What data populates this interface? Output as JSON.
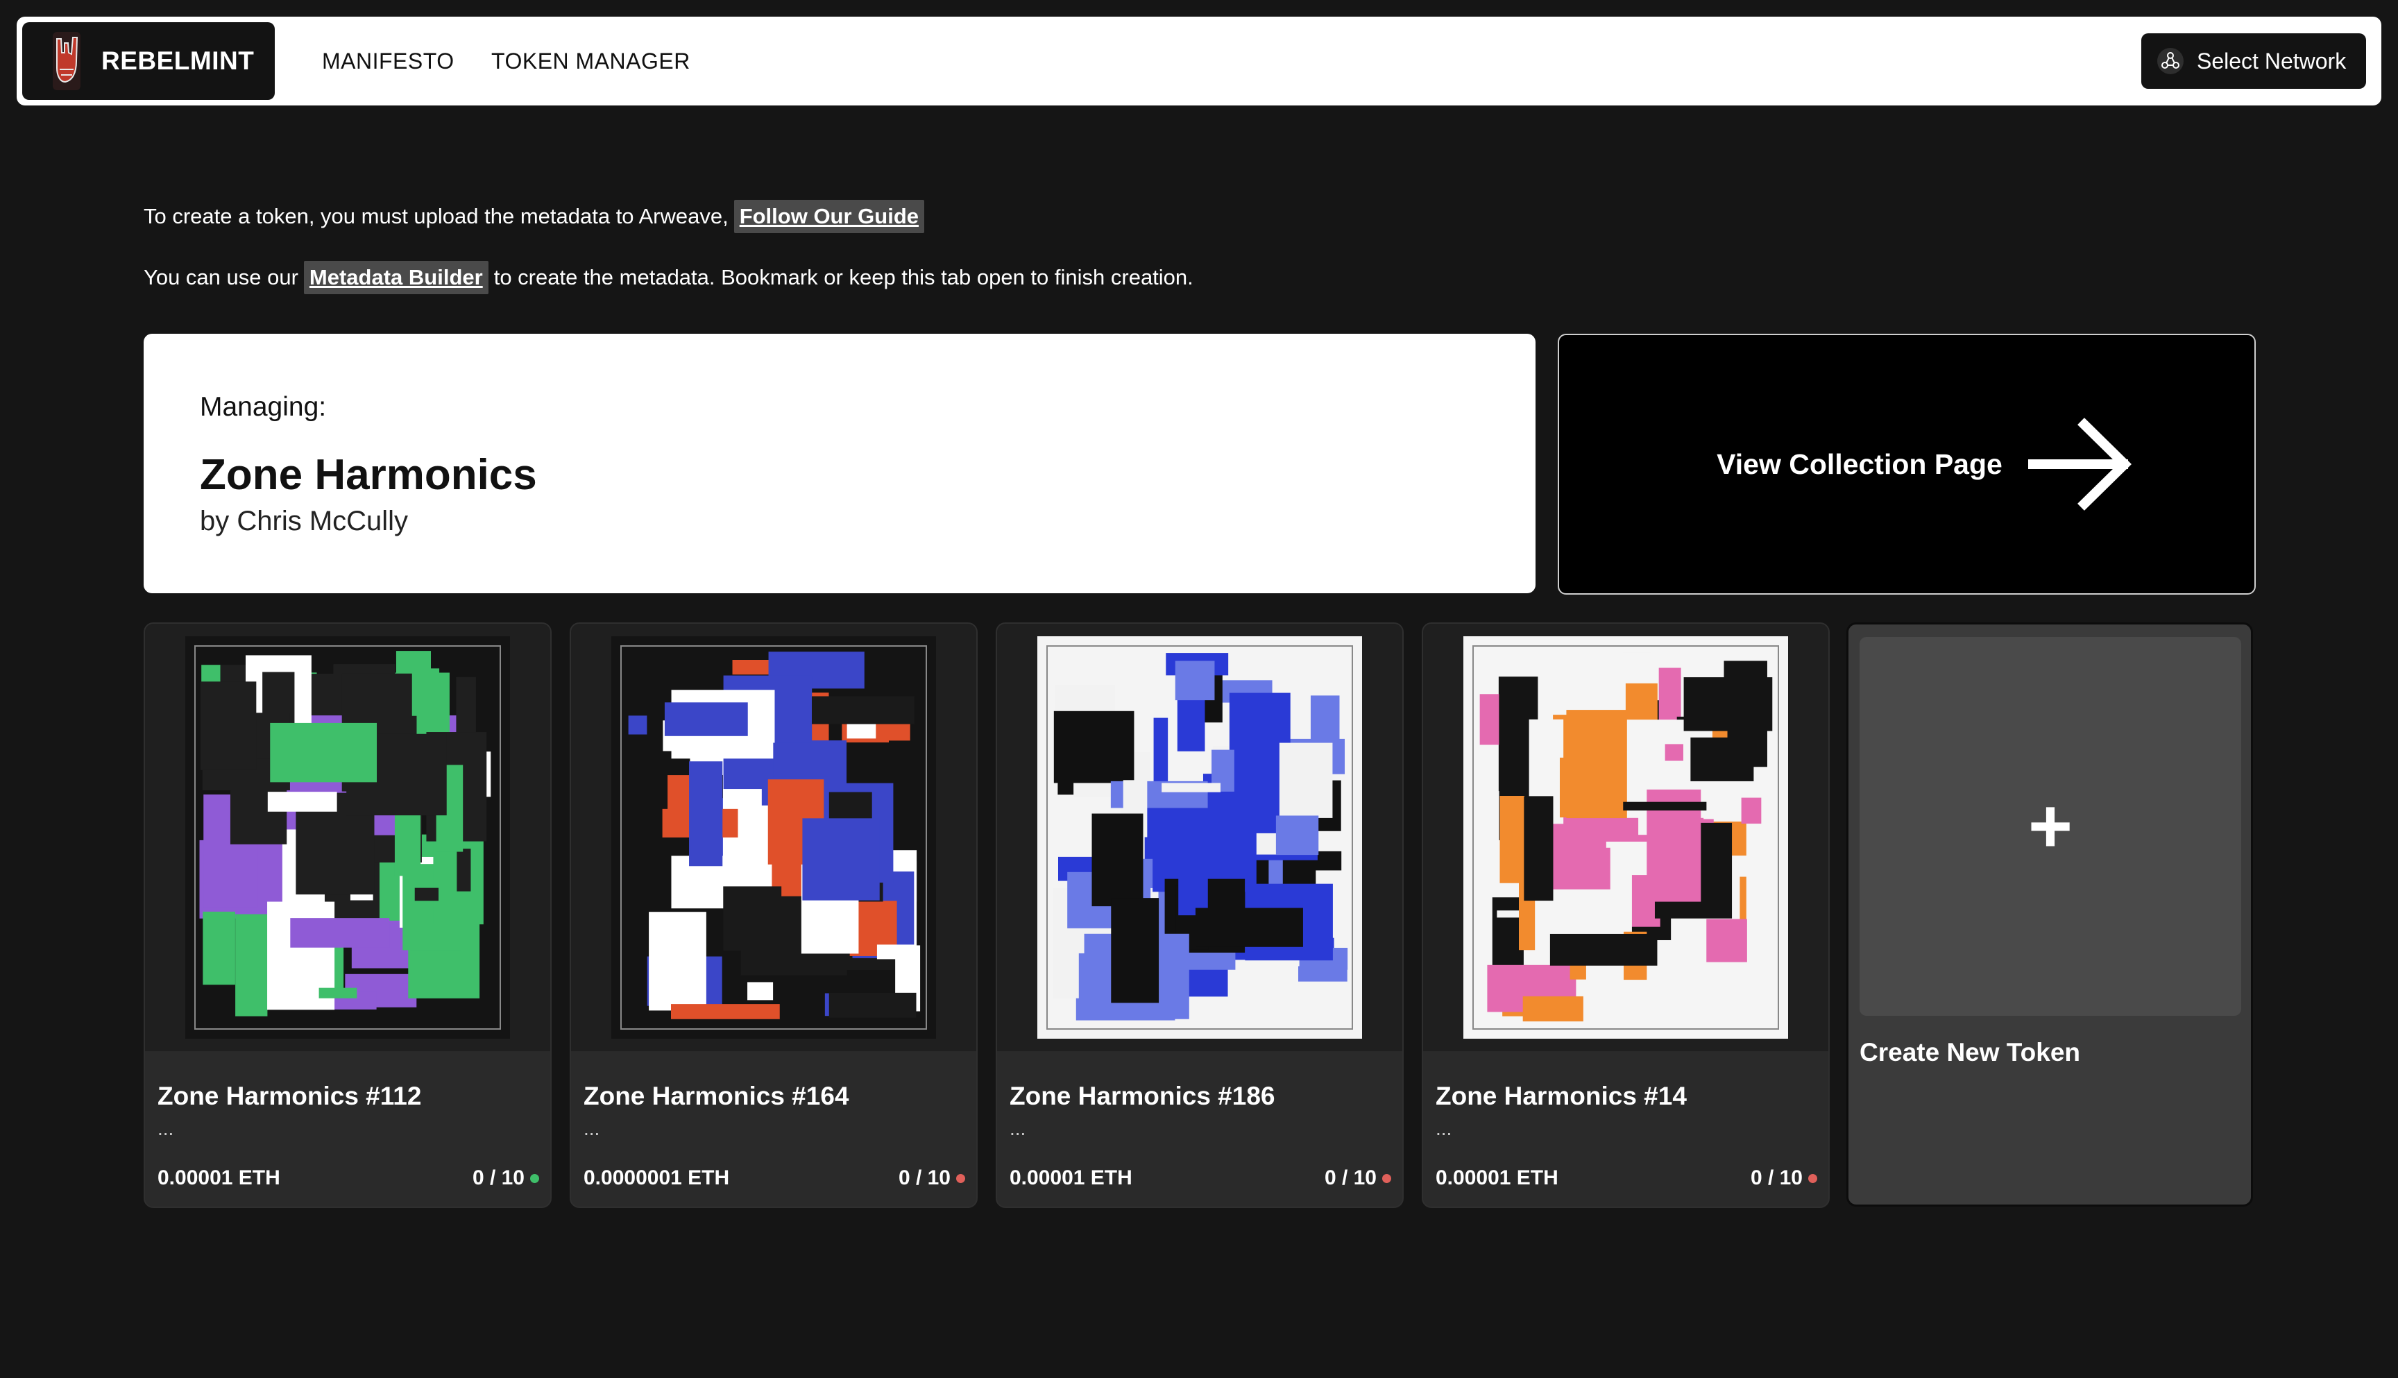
{
  "header": {
    "brand": "REBELMINT",
    "nav": [
      "MANIFESTO",
      "TOKEN MANAGER"
    ],
    "network_button": "Select Network"
  },
  "info": {
    "line1_text": "To create a token, you must upload the metadata to Arweave,",
    "line1_link": "Follow Our Guide",
    "line2_prefix": "You can use our",
    "line2_link": "Metadata Builder",
    "line2_suffix": "to create the metadata. Bookmark or keep this tab open to finish creation."
  },
  "managing": {
    "label": "Managing:",
    "title": "Zone Harmonics",
    "by": "by Chris McCully"
  },
  "view_collection": {
    "label": "View Collection Page",
    "icon": "arrow-right-icon"
  },
  "tokens": [
    {
      "name": "Zone Harmonics #112",
      "desc": "...",
      "price": "0.00001 ETH",
      "supply": "0 / 10",
      "status_color": "#3fbf6a",
      "palette": [
        "#8f5bd6",
        "#ffffff",
        "#1f1f1f",
        "#3fbf6a"
      ]
    },
    {
      "name": "Zone Harmonics #164",
      "desc": "...",
      "price": "0.0000001 ETH",
      "supply": "0 / 10",
      "status_color": "#e0605a",
      "palette": [
        "#e0502a",
        "#3b46c8",
        "#ffffff",
        "#1a1a1a"
      ]
    },
    {
      "name": "Zone Harmonics #186",
      "desc": "...",
      "price": "0.00001 ETH",
      "supply": "0 / 10",
      "status_color": "#e0605a",
      "palette": [
        "#2a3ad6",
        "#f2f2f2",
        "#111111",
        "#6a7ae6"
      ]
    },
    {
      "name": "Zone Harmonics #14",
      "desc": "...",
      "price": "0.00001 ETH",
      "supply": "0 / 10",
      "status_color": "#e0605a",
      "palette": [
        "#e46ab0",
        "#f28b2e",
        "#f5f5f5",
        "#141414"
      ]
    }
  ],
  "create_token": {
    "label": "Create New Token",
    "icon": "plus-icon"
  }
}
